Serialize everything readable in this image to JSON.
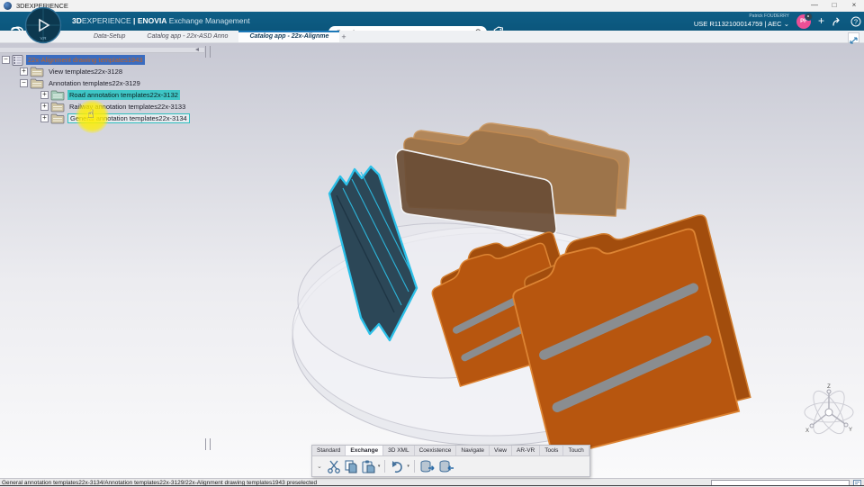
{
  "window": {
    "title": "3DEXPERIENCE",
    "controls": {
      "minimize": "—",
      "restore": "□",
      "close": "×"
    }
  },
  "app_bar": {
    "brand_3d": "3D",
    "brand_rest": "EXPERIENCE",
    "separator": "|",
    "app_name": "ENOVIA",
    "module": "Exchange Management",
    "search_placeholder": "Search",
    "user_name": "Patrick FOUDERRY",
    "session": "USE R1132100014759 | AEC",
    "session_caret": "⌄",
    "avatar_initials": "PF",
    "add_label": "+"
  },
  "compass": {
    "label": "V.R"
  },
  "tabs": {
    "items": [
      {
        "label": "Data-Setup",
        "active": false
      },
      {
        "label": "Catalog app - 22x-ASD Anno",
        "active": false
      },
      {
        "label": "Catalog app - 22x-Alignme",
        "active": true
      }
    ],
    "new_tab_label": "+"
  },
  "tree": {
    "items": [
      {
        "label": "22x-Alignment drawing templates1943",
        "expander": "−",
        "depth": 0,
        "state": "selected-blue"
      },
      {
        "label": "View templates22x-3128",
        "expander": "+",
        "depth": 1,
        "state": "none"
      },
      {
        "label": "Annotation templates22x-3129",
        "expander": "−",
        "depth": 1,
        "state": "none"
      },
      {
        "label": "Road annotation templates22x-3132",
        "expander": "+",
        "depth": 2,
        "state": "highlighted-cyan"
      },
      {
        "label": "Railway annotation templates22x-3133",
        "expander": "+",
        "depth": 2,
        "state": "none"
      },
      {
        "label": "General annotation templates22x-3134",
        "expander": "+",
        "depth": 2,
        "state": "preselected"
      }
    ]
  },
  "viewport": {
    "axis": {
      "z": "Z",
      "x": "X",
      "y": "Y"
    }
  },
  "toolbar": {
    "tabs": [
      "Standard",
      "Exchange",
      "3D XML",
      "Coexistence",
      "Navigate",
      "View",
      "AR-VR",
      "Tools",
      "Touch"
    ],
    "active_tab": "Exchange",
    "overflow_chevron": "⌄",
    "dropdown_glyph": "▾",
    "icons": [
      "cut-icon",
      "copy-icon",
      "paste-icon",
      "undo-icon",
      "db-export-icon",
      "db-import-icon"
    ]
  },
  "status_bar": {
    "message": "General annotation templates22x-3134/Annotation templates22x-3129/22x-Alignment drawing templates1943 preselected",
    "command_value": ""
  },
  "icons": {
    "top_bar": [
      "search-icon",
      "tag-icon",
      "add-icon",
      "share-icon",
      "help-icon",
      "expand-viewport-icon"
    ],
    "tree": [
      "catalog-icon",
      "folder-icon"
    ],
    "cursor": "hand-cursor"
  },
  "colors": {
    "brand_blue": "#0e5a80",
    "selection_blue": "#3a6cc0",
    "selection_text_orange": "#c4631f",
    "highlight_cyan": "#3ec6c6",
    "folder_orange": "#b7560f",
    "folder_brown": "#6b4d36",
    "stack_teal": "#2c4757",
    "stack_outline_cyan": "#2cc0e8",
    "avatar_pink": "#ec4f96",
    "cursor_yellow": "#ffee00"
  }
}
